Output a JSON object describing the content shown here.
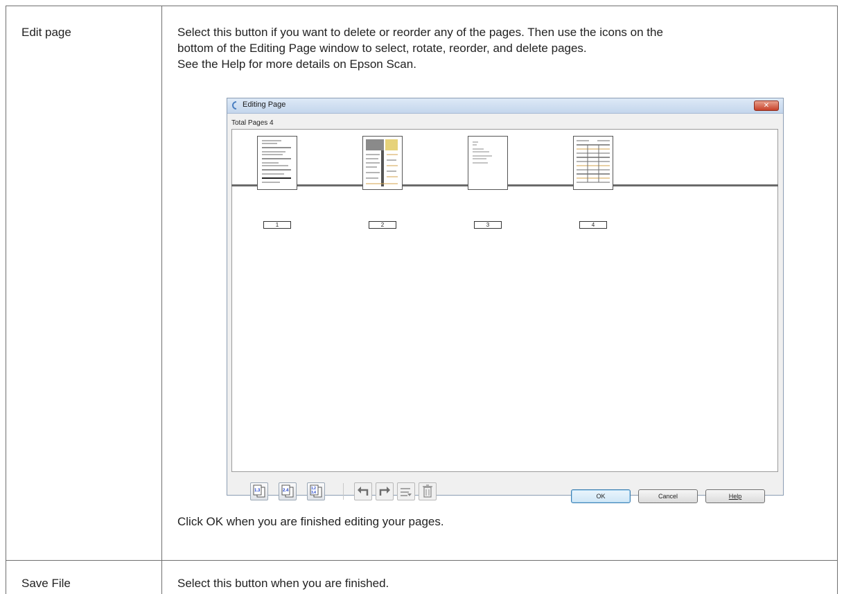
{
  "table": {
    "rows": [
      {
        "label": "Edit page",
        "desc_line1": "Select this button if you want to delete or reorder any of the pages. Then use the icons on the",
        "desc_line2": "bottom of the Editing Page window to select, rotate, reorder, and delete pages.",
        "desc_line3": "See the Help for more details on Epson Scan.",
        "footer": "Click OK when you are finished editing your pages."
      },
      {
        "label": "Save File",
        "desc": "Select this button when you are finished."
      }
    ]
  },
  "dialog": {
    "title": "Editing Page",
    "close_label": "✕",
    "total_pages": "Total Pages 4",
    "pages": [
      {
        "number": "1"
      },
      {
        "number": "2"
      },
      {
        "number": "3"
      },
      {
        "number": "4"
      }
    ],
    "toolbar_icons": [
      "select-odd-pages-icon",
      "select-even-pages-icon",
      "select-all-pages-icon",
      "rotate-left-icon",
      "rotate-right-icon",
      "reorder-pages-icon",
      "delete-page-icon"
    ],
    "buttons": {
      "ok": "OK",
      "cancel": "Cancel",
      "help": "Help"
    }
  },
  "colors": {
    "titlebar": "#c4d6ec",
    "close": "#c7412a",
    "ok_border": "#3c7fb1",
    "icon_blue": "#1d3fc9"
  }
}
